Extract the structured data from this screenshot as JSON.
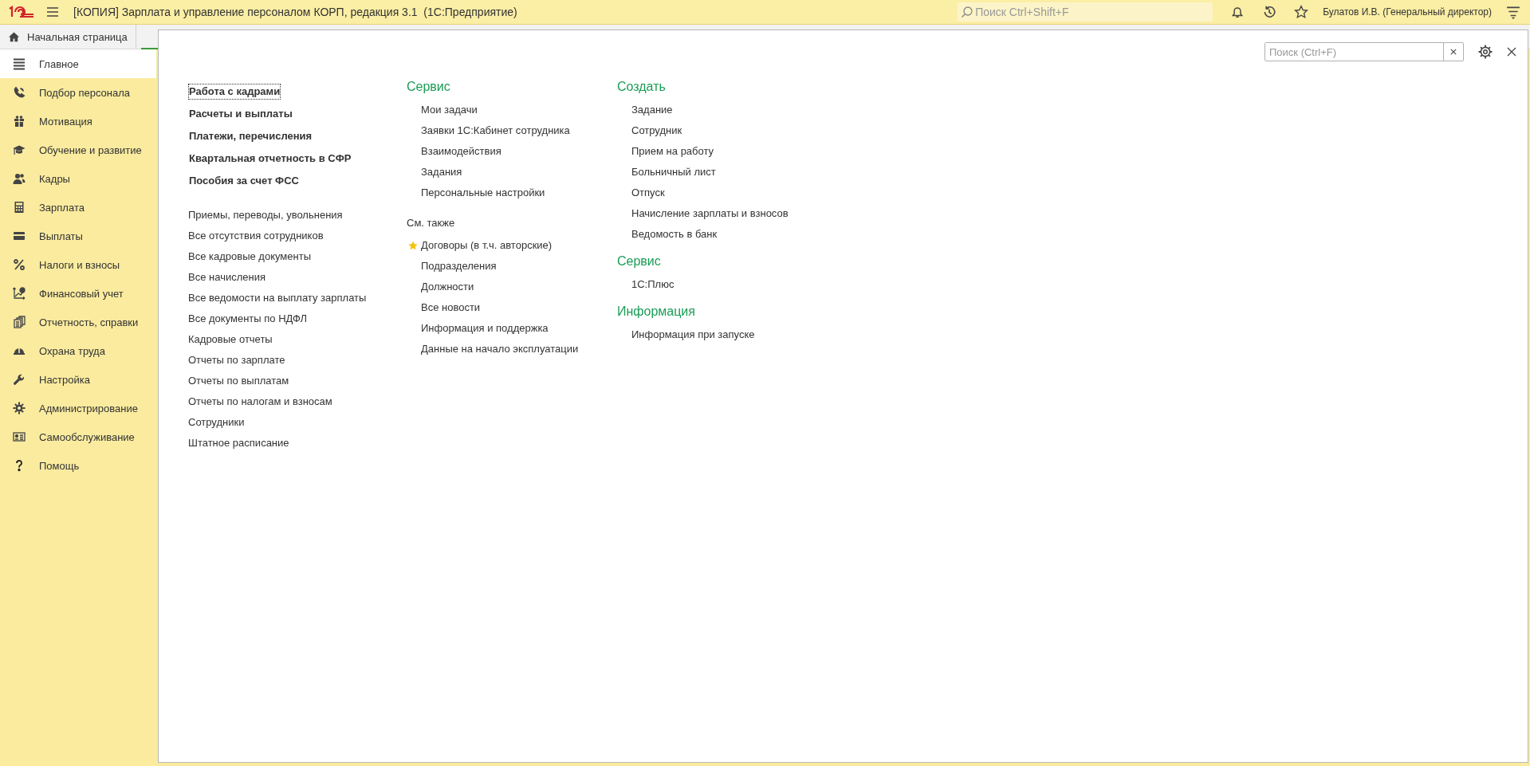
{
  "window": {
    "title": "[КОПИЯ] Зарплата и управление персоналом КОРП, редакция 3.1  (1С:Предприятие)"
  },
  "top_search": {
    "placeholder": "Поиск Ctrl+Shift+F"
  },
  "user": "Булатов И.В. (Генеральный директор)",
  "home_tab": {
    "label": "Начальная страница"
  },
  "sidebar": {
    "items": [
      {
        "label": "Главное",
        "selected": true
      },
      {
        "label": "Подбор персонала",
        "selected": false
      },
      {
        "label": "Мотивация",
        "selected": false
      },
      {
        "label": "Обучение и развитие",
        "selected": false
      },
      {
        "label": "Кадры",
        "selected": false
      },
      {
        "label": "Зарплата",
        "selected": false
      },
      {
        "label": "Выплаты",
        "selected": false
      },
      {
        "label": "Налоги и взносы",
        "selected": false
      },
      {
        "label": "Финансовый учет",
        "selected": false
      },
      {
        "label": "Отчетность, справки",
        "selected": false
      },
      {
        "label": "Охрана труда",
        "selected": false
      },
      {
        "label": "Настройка",
        "selected": false
      },
      {
        "label": "Администрирование",
        "selected": false
      },
      {
        "label": "Самообслуживание",
        "selected": false
      },
      {
        "label": "Помощь",
        "selected": false
      }
    ]
  },
  "panel": {
    "search": {
      "placeholder": "Поиск (Ctrl+F)"
    },
    "sections": [
      {
        "label": "Работа с кадрами",
        "focused": true
      },
      {
        "label": "Расчеты и выплаты",
        "focused": false
      },
      {
        "label": "Платежи, перечисления",
        "focused": false
      },
      {
        "label": "Квартальная отчетность в СФР",
        "focused": false
      },
      {
        "label": "Пособия за счет ФСС",
        "focused": false
      }
    ],
    "links": [
      "Приемы, переводы, увольнения",
      "Все отсутствия сотрудников",
      "Все кадровые документы",
      "Все начисления",
      "Все ведомости на выплату зарплаты",
      "Все документы по НДФЛ",
      "Кадровые отчеты",
      "Отчеты по зарплате",
      "Отчеты по выплатам",
      "Отчеты по налогам и взносам",
      "Сотрудники",
      "Штатное расписание"
    ],
    "service": {
      "title": "Сервис",
      "items": [
        "Мои задачи",
        "Заявки 1С:Кабинет сотрудника",
        "Взаимодействия",
        "Задания",
        "Персональные настройки"
      ]
    },
    "see_also": {
      "title": "См. также",
      "items": [
        {
          "label": "Договоры (в т.ч. авторские)",
          "starred": true
        },
        {
          "label": "Подразделения",
          "starred": false
        },
        {
          "label": "Должности",
          "starred": false
        },
        {
          "label": "Все новости",
          "starred": false
        },
        {
          "label": "Информация и поддержка",
          "starred": false
        },
        {
          "label": "Данные на начало эксплуатации",
          "starred": false
        }
      ]
    },
    "groups": [
      {
        "title": "Создать",
        "items": [
          "Задание",
          "Сотрудник",
          "Прием на работу",
          "Больничный лист",
          "Отпуск",
          "Начисление зарплаты и взносов",
          "Ведомость в банк"
        ]
      },
      {
        "title": "Сервис",
        "items": [
          "1С:Плюс"
        ]
      },
      {
        "title": "Информация",
        "items": [
          "Информация при запуске"
        ]
      }
    ]
  }
}
